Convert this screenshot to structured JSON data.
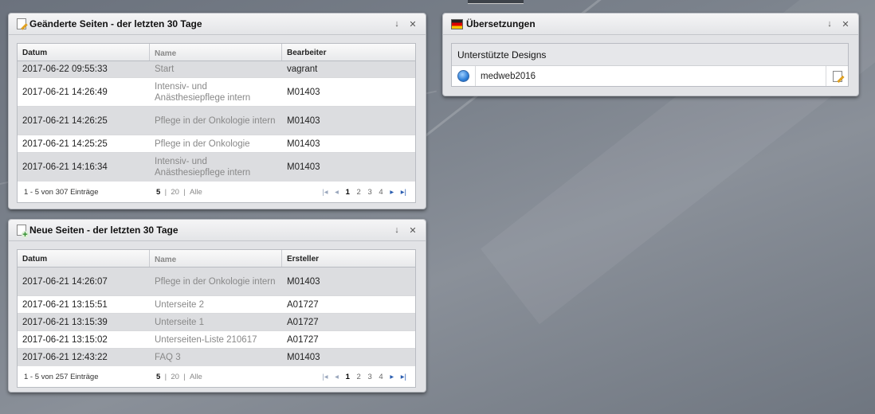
{
  "widgets": {
    "changed": {
      "title": "Geänderte Seiten - der letzten 30 Tage",
      "columns": [
        "Datum",
        "Name",
        "Bearbeiter"
      ],
      "rows": [
        {
          "date": "2017-06-22 09:55:33",
          "name": "Start",
          "user": "vagrant"
        },
        {
          "date": "2017-06-21 14:26:49",
          "name": "Intensiv- und Anästhesiepflege intern",
          "user": "M01403"
        },
        {
          "date": "2017-06-21 14:26:25",
          "name": "Pflege in der Onkologie intern",
          "user": "M01403"
        },
        {
          "date": "2017-06-21 14:25:25",
          "name": "Pflege in der Onkologie",
          "user": "M01403"
        },
        {
          "date": "2017-06-21 14:16:34",
          "name": "Intensiv- und Anästhesiepflege intern",
          "user": "M01403"
        }
      ],
      "pager": {
        "count": "1 - 5 von 307 Einträge",
        "size_5": "5",
        "size_20": "20",
        "size_all": "Alle",
        "pages": [
          "1",
          "2",
          "3",
          "4"
        ],
        "current": "1"
      }
    },
    "new": {
      "title": "Neue Seiten - der letzten 30 Tage",
      "columns": [
        "Datum",
        "Name",
        "Ersteller"
      ],
      "rows": [
        {
          "date": "2017-06-21 14:26:07",
          "name": "Pflege in der Onkologie intern",
          "user": "M01403"
        },
        {
          "date": "2017-06-21 13:15:51",
          "name": "Unterseite 2",
          "user": "A01727"
        },
        {
          "date": "2017-06-21 13:15:39",
          "name": "Unterseite 1",
          "user": "A01727"
        },
        {
          "date": "2017-06-21 13:15:02",
          "name": "Unterseiten-Liste 210617",
          "user": "A01727"
        },
        {
          "date": "2017-06-21 12:43:22",
          "name": "FAQ 3",
          "user": "M01403"
        }
      ],
      "pager": {
        "count": "1 - 5 von 257 Einträge",
        "size_5": "5",
        "size_20": "20",
        "size_all": "Alle",
        "pages": [
          "1",
          "2",
          "3",
          "4"
        ],
        "current": "1"
      }
    },
    "translations": {
      "title": "Übersetzungen",
      "section": "Unterstützte Designs",
      "design": "medweb2016"
    }
  },
  "header_buttons": {
    "collapse": "↓",
    "close": "✕"
  },
  "pager_arrows": {
    "first": "|◂",
    "prev": "◂",
    "next": "▸",
    "last": "▸|"
  },
  "icons": {
    "changed": "page-edit-icon",
    "new": "page-add-icon",
    "translations": "flag-icon",
    "design": "globe-icon",
    "edit": "edit-icon"
  }
}
